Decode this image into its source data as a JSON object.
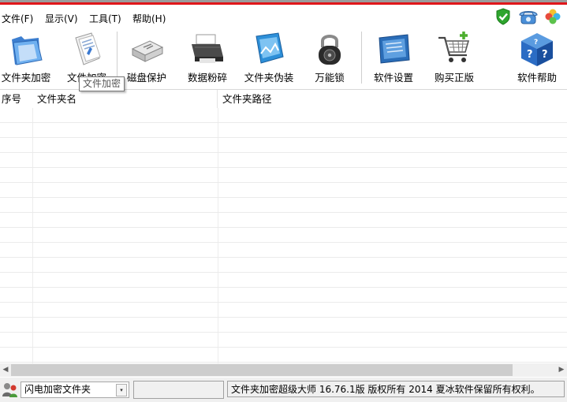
{
  "menu": {
    "items": [
      {
        "label": "文件(F)"
      },
      {
        "label": "显示(V)"
      },
      {
        "label": "工具(T)"
      },
      {
        "label": "帮助(H)"
      }
    ]
  },
  "toolbar": {
    "buttons": [
      {
        "label": "文件夹加密",
        "icon": "folder-encrypt-icon"
      },
      {
        "label": "文件加密",
        "icon": "file-encrypt-icon"
      },
      {
        "label": "磁盘保护",
        "icon": "disk-protect-icon"
      },
      {
        "label": "数据粉碎",
        "icon": "shredder-icon"
      },
      {
        "label": "文件夹伪装",
        "icon": "folder-disguise-icon"
      },
      {
        "label": "万能锁",
        "icon": "padlock-icon"
      },
      {
        "label": "软件设置",
        "icon": "settings-icon"
      },
      {
        "label": "购买正版",
        "icon": "cart-icon"
      },
      {
        "label": "软件帮助",
        "icon": "help-cube-icon"
      }
    ]
  },
  "tooltip": {
    "text": "文件加密"
  },
  "table": {
    "columns": [
      "序号",
      "文件夹名",
      "文件夹路径"
    ],
    "rows": []
  },
  "status": {
    "combo_value": "闪电加密文件夹",
    "middle_text": "",
    "copyright": "文件夹加密超级大师 16.76.1版 版权所有 2014 夏冰软件保留所有权利。"
  },
  "colors": {
    "accent_red": "#e0161b",
    "shield_green": "#2ea52e"
  }
}
